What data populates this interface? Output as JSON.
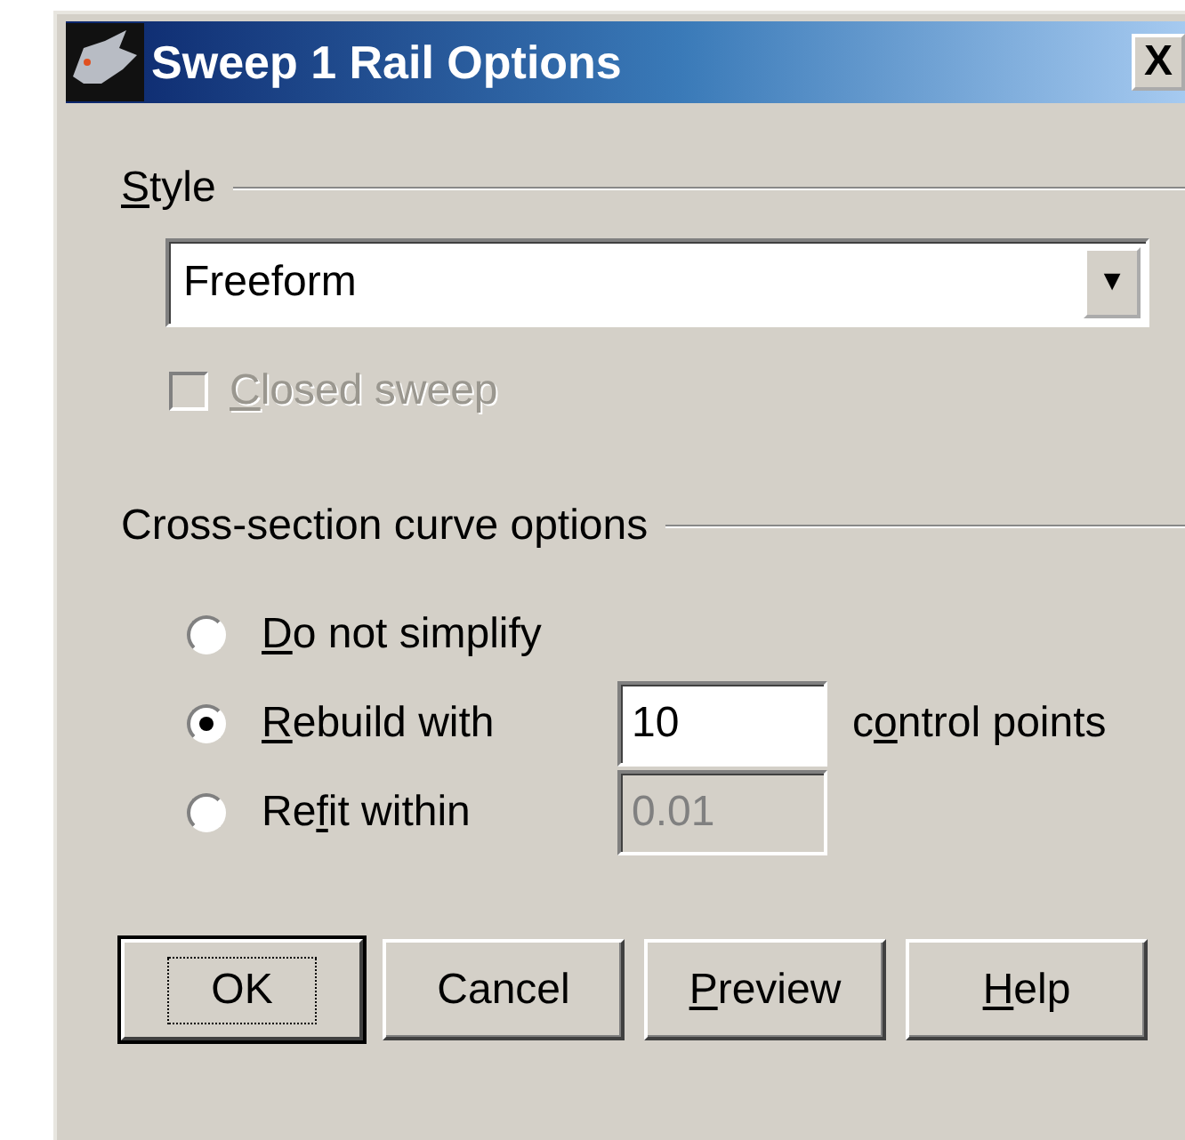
{
  "window": {
    "title": "Sweep 1 Rail Options",
    "close": "X"
  },
  "style_group": {
    "label": {
      "key": "S",
      "post": "tyle"
    },
    "dropdown": {
      "value": "Freeform",
      "arrow": "▼"
    },
    "closed_sweep": {
      "label": {
        "key": "C",
        "post": "losed sweep"
      },
      "checked": false,
      "disabled": true
    }
  },
  "cross_section_group": {
    "label": {
      "pre": "Cross-section curve options"
    },
    "options": [
      {
        "label": {
          "key": "D",
          "post": "o not simplify"
        },
        "selected": false
      },
      {
        "label": {
          "key": "R",
          "post": "ebuild with"
        },
        "selected": true,
        "field": {
          "value": "10",
          "disabled": false
        },
        "suffix": {
          "pre": "c",
          "key": "o",
          "post": "ntrol points"
        }
      },
      {
        "label": {
          "pre": "Re",
          "key": "f",
          "post": "it within"
        },
        "selected": false,
        "field": {
          "value": "0.01",
          "disabled": true
        }
      }
    ]
  },
  "buttons": [
    {
      "label": {
        "pre": "OK"
      },
      "default": true
    },
    {
      "label": {
        "pre": "Cancel"
      },
      "default": false
    },
    {
      "label": {
        "key": "P",
        "post": "review"
      },
      "default": false
    },
    {
      "label": {
        "key": "H",
        "post": "elp"
      },
      "default": false
    }
  ]
}
